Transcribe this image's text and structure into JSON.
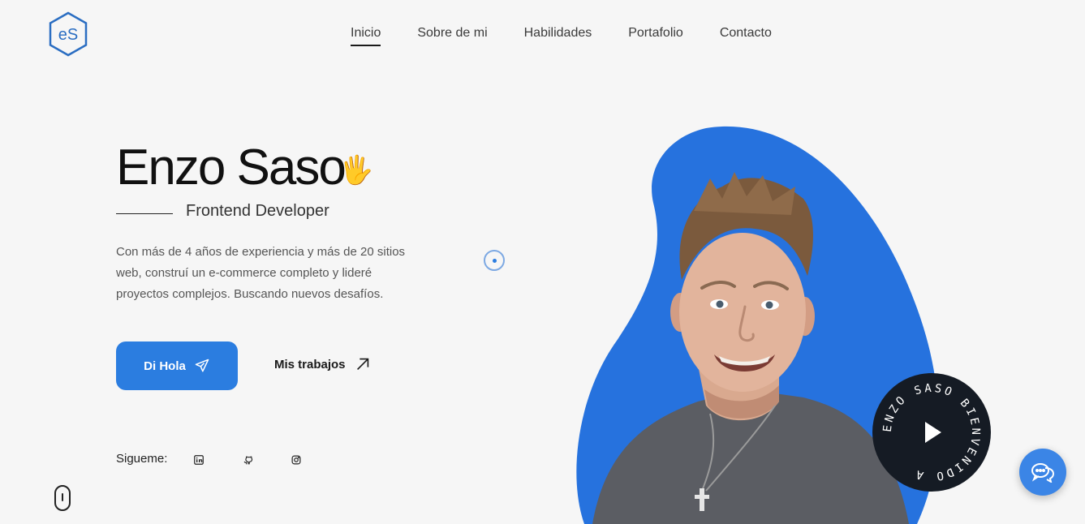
{
  "logo": {
    "text": "eS",
    "color": "#2b6ec2"
  },
  "nav": [
    {
      "label": "Inicio",
      "active": true
    },
    {
      "label": "Sobre de mi"
    },
    {
      "label": "Habilidades"
    },
    {
      "label": "Portafolio"
    },
    {
      "label": "Contacto"
    }
  ],
  "hero": {
    "name": "Enzo Saso",
    "wave_emoji": "🖐",
    "role": "Frontend Developer",
    "description": "Con más de 4 años de experiencia y más de 20 sitios web, construí un e-commerce completo y lideré proyectos complejos. Buscando nuevos desafíos.",
    "primary_button": "Di Hola",
    "secondary_button": "Mis trabajos",
    "follow_label": "Sigueme:",
    "socials": [
      "linkedin-icon",
      "github-icon",
      "instagram-icon"
    ],
    "blob_color": "#2672de",
    "badge_text": "ENZO SASO BIENVENIDO A"
  },
  "colors": {
    "accent": "#2b7de0",
    "background": "#f6f6f6",
    "badge": "#151b24"
  }
}
